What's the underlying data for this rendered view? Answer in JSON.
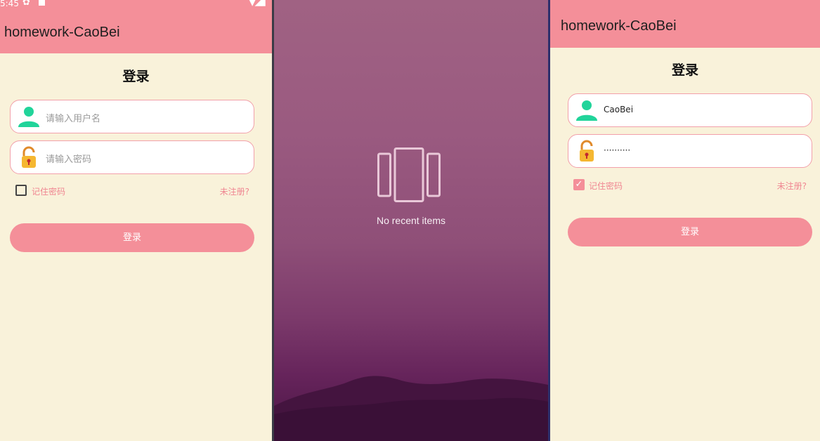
{
  "left": {
    "status": {
      "time": "5:45"
    },
    "app_title": "homework-CaoBei",
    "page_title": "登录",
    "username_placeholder": "请输入用户名",
    "password_placeholder": "请输入密码",
    "remember_label": "记住密码",
    "remember_checked": false,
    "register_link": "未注册?",
    "login_button": "登录"
  },
  "middle": {
    "empty_text": "No recent items"
  },
  "right": {
    "app_title": "homework-CaoBei",
    "page_title": "登录",
    "username_value": "CaoBei",
    "password_value": "··········",
    "remember_label": "记住密码",
    "remember_checked": true,
    "register_link": "未注册?",
    "login_button": "登录"
  },
  "colors": {
    "app_bar": "#f48f99",
    "background": "#f9f2da",
    "accent_text": "#f08792",
    "user_icon": "#21d49a",
    "lock_icon": "#f5b731"
  },
  "icons": [
    "user-icon",
    "lock-open-icon",
    "recents-icon",
    "settings-icon"
  ]
}
